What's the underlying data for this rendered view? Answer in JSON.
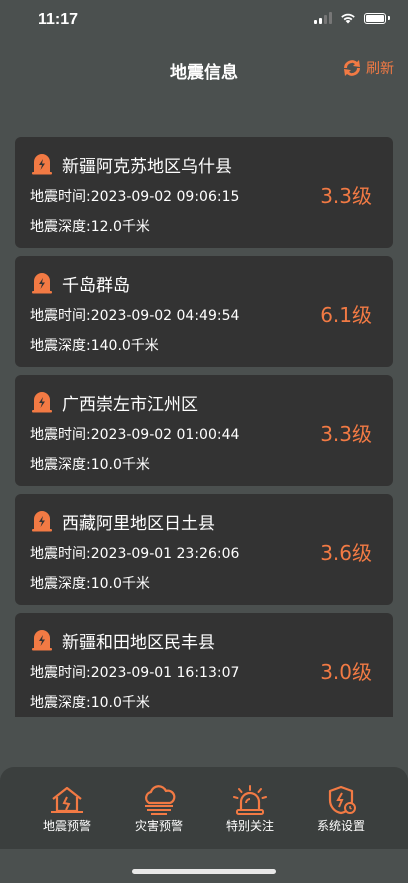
{
  "status": {
    "time": "11:17"
  },
  "header": {
    "title": "地震信息",
    "refresh_label": "刷新"
  },
  "accent_color": "#f27a44",
  "quakes": [
    {
      "place": "新疆阿克苏地区乌什县",
      "time": "地震时间:2023-09-02 09:06:15",
      "depth": "地震深度:12.0千米",
      "magnitude": "3.3级"
    },
    {
      "place": "千岛群岛",
      "time": "地震时间:2023-09-02 04:49:54",
      "depth": "地震深度:140.0千米",
      "magnitude": "6.1级"
    },
    {
      "place": "广西崇左市江州区",
      "time": "地震时间:2023-09-02 01:00:44",
      "depth": "地震深度:10.0千米",
      "magnitude": "3.3级"
    },
    {
      "place": "西藏阿里地区日土县",
      "time": "地震时间:2023-09-01 23:26:06",
      "depth": "地震深度:10.0千米",
      "magnitude": "3.6级"
    },
    {
      "place": "新疆和田地区民丰县",
      "time": "地震时间:2023-09-01 16:13:07",
      "depth": "地震深度:10.0千米",
      "magnitude": "3.0级"
    }
  ],
  "tabs": [
    {
      "label": "地震预警",
      "icon": "house-quake-icon"
    },
    {
      "label": "灾害预警",
      "icon": "cloud-warning-icon"
    },
    {
      "label": "特别关注",
      "icon": "alarm-light-icon"
    },
    {
      "label": "系统设置",
      "icon": "shield-settings-icon"
    }
  ]
}
